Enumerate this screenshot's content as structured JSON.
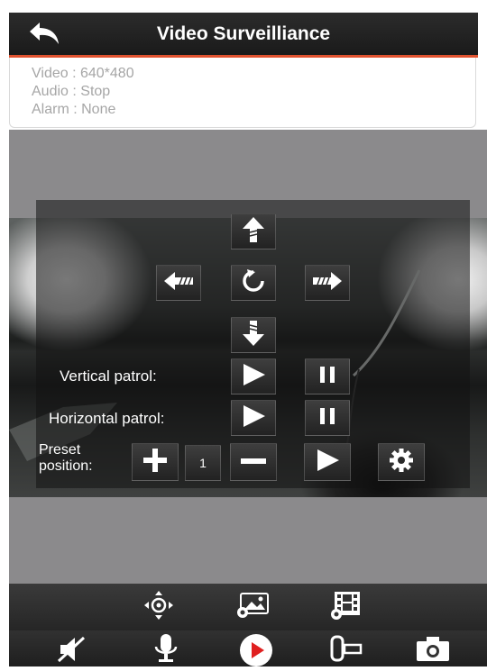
{
  "header": {
    "title": "Video Surveilliance"
  },
  "status": {
    "video_label": "Video : ",
    "video_value": "640*480",
    "audio_label": "Audio : ",
    "audio_value": "Stop",
    "alarm_label": "Alarm : ",
    "alarm_value": "None"
  },
  "ptz": {
    "vertical_patrol_label": "Vertical patrol:",
    "horizontal_patrol_label": "Horizontal patrol:",
    "preset_label_line1": "Preset",
    "preset_label_line2": "position:",
    "preset_value": "1"
  },
  "colors": {
    "accent": "#e0522f",
    "record_button": "#e02020",
    "topbar": "#1f1f1f"
  },
  "icons": {
    "top_toolbar": [
      "ptz-icon",
      "image-settings-icon",
      "video-settings-icon"
    ],
    "bottom_toolbar": [
      "mute-icon",
      "microphone-icon",
      "play-record-icon",
      "camera-switch-icon",
      "snapshot-icon"
    ]
  }
}
